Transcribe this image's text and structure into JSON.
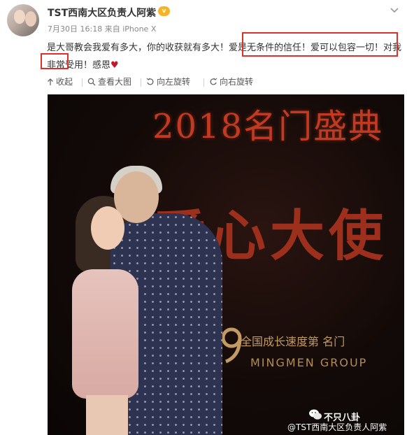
{
  "post": {
    "username": "TST西南大区负责人阿紫",
    "vip_badge": "v",
    "timestamp": "7月30日 16:18",
    "source": "来自 iPhone X",
    "text_part1": "是大哥教会我爱有多大，你的收获就有多大！",
    "text_part2": "爱是无条件的信任！爱可以包容一",
    "text_part3": "切！",
    "text_part4": "对我非常受用！感恩",
    "heart": "♥"
  },
  "toolbar": {
    "collapse_label": "收起",
    "view_large_label": "查看大图",
    "rotate_left_label": "向左旋转",
    "rotate_right_label": "向右旋转"
  },
  "photo": {
    "banner_year": "2018名门盛典",
    "banner_big": "爱心大使",
    "banner_sub": "全国成长速度第  名门",
    "banner_brand": "MINGMEN GROUP",
    "watermark_account": "不只八卦",
    "watermark_user": "@TST西南大区负责人阿紫"
  },
  "colors": {
    "highlight_border": "#d9312c",
    "vip_badge": "#f5b32a",
    "heart": "#c0182a"
  }
}
